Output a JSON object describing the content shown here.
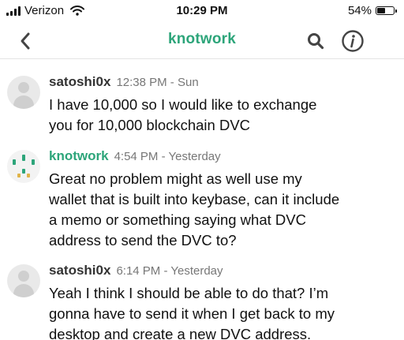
{
  "statusbar": {
    "carrier": "Verizon",
    "time": "10:29 PM",
    "battery": "54%",
    "battery_level": 0.54
  },
  "header": {
    "title": "knotwork",
    "title_color": "#2da57a",
    "back_icon": "chevron-left-icon",
    "search_icon": "search-icon",
    "info_icon": "info-icon"
  },
  "messages": [
    {
      "author": "satoshi0x",
      "time": "12:38 PM - Sun",
      "lines": [
        "I have 10,000 so I would like to exchange",
        "you for 10,000 blockchain DVC"
      ]
    },
    {
      "author": "knotwork",
      "time": "4:54 PM - Yesterday",
      "lines": [
        "Great no problem might as well use my",
        "wallet that is built into keybase, can it include",
        "a memo or something saying what DVC",
        "address to send the DVC to?"
      ]
    },
    {
      "author": "satoshi0x",
      "time": "6:14 PM - Yesterday",
      "lines": [
        "Yeah I think I should be able to do that? I’m",
        "gonna have to send it when I get back to my",
        "desktop and create a new DVC address."
      ]
    }
  ]
}
